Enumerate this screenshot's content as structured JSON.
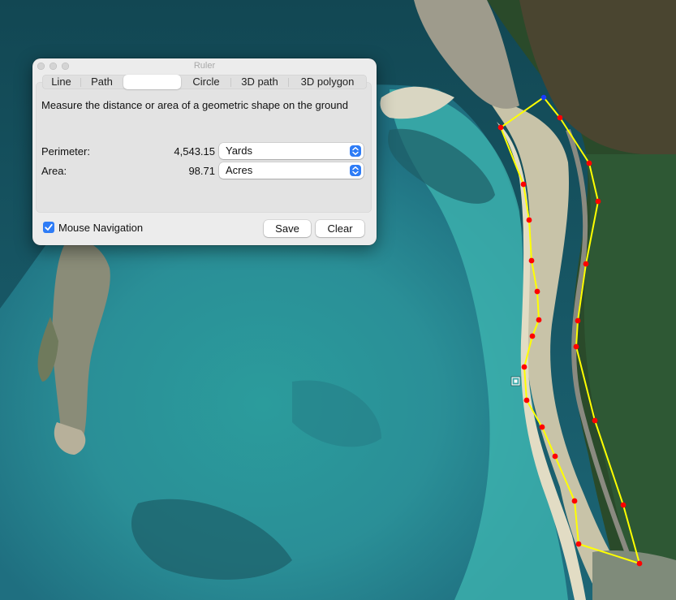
{
  "window": {
    "title": "Ruler"
  },
  "tabs": [
    {
      "label": "Line"
    },
    {
      "label": "Path"
    },
    {
      "label": ""
    },
    {
      "label": "Circle"
    },
    {
      "label": "3D path"
    },
    {
      "label": "3D polygon"
    }
  ],
  "selected_tab_index": 2,
  "description": "Measure the distance or area of a geometric shape on the ground",
  "measurements": {
    "perimeter": {
      "label": "Perimeter:",
      "value": "4,543.15",
      "unit": "Yards"
    },
    "area": {
      "label": "Area:",
      "value": "98.71",
      "unit": "Acres"
    }
  },
  "mouse_navigation": {
    "label": "Mouse Navigation",
    "checked": true
  },
  "buttons": {
    "save": "Save",
    "clear": "Clear"
  },
  "colors": {
    "polygon_line": "#ffff00",
    "vertex": "#ff0000",
    "first_vertex": "#1a3cff",
    "accent": "#2e7cf6"
  },
  "icons": [
    "chevron-updown-icon",
    "checkmark-icon",
    "placemark-target-icon"
  ]
}
